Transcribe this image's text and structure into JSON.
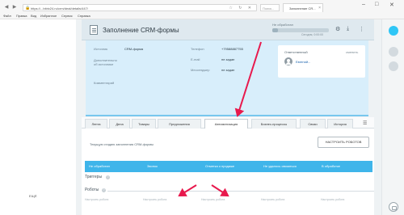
{
  "browser": {
    "url": "https://...bitrix24.ru/crm/deal/details/447/",
    "search_placeholder": "Поиск...",
    "tab_title": "Заполнение CR...",
    "menu": [
      "Файл",
      "Правка",
      "Вид",
      "Избранное",
      "Сервис",
      "Справка"
    ]
  },
  "slider": {
    "title": "Заполнение CRM-формы",
    "status_label": "Не обработан",
    "status_progress": 0.1,
    "status_time": "Сегодня, 0:00:00",
    "fields": {
      "source_label": "Источник",
      "source_value": "CRM-форма",
      "extra_label": "Дополнительно\nоб источнике",
      "comment_label": "Комментарий",
      "phone_label": "Телефон",
      "phone_value": "+79588887755",
      "email_label": "E-mail",
      "email_value": "не задан",
      "messenger_label": "Мессенджер",
      "messenger_value": "не задан"
    },
    "responsible": {
      "title": "Ответственный",
      "change": "сменить",
      "name": "Евгений..."
    }
  },
  "tabs": [
    {
      "label": "Лента",
      "active": false
    },
    {
      "label": "Дела",
      "active": false
    },
    {
      "label": "Товары",
      "active": false
    },
    {
      "label": "Предложения",
      "active": false
    },
    {
      "label": "Автоматизация",
      "active": true
    },
    {
      "label": "Бизнес-процессы",
      "active": false
    },
    {
      "label": "Связи",
      "active": false
    },
    {
      "label": "История",
      "active": false
    }
  ],
  "automation": {
    "description": "Текущую стадию заполнения CRM-формы",
    "config_button": "НАСТРОИТЬ РОБОТОВ",
    "stages": [
      "Не обработан",
      "Звонок",
      "Отметка о продаже",
      "Не удалось связаться",
      "В обработке"
    ],
    "triggers_title": "Триггеры",
    "robots_title": "Роботы",
    "add_robot_labels": [
      "Настроить робота",
      "Настроить робота",
      "Настроить робота",
      "Настроить робота",
      "Настроить робота"
    ]
  },
  "left_panel": {
    "more_label": "ЕЩЁ"
  },
  "colors": {
    "stage_blue": "#3fb5ea",
    "card_blue": "#d8eefb",
    "arrow_red": "#e8194d"
  }
}
